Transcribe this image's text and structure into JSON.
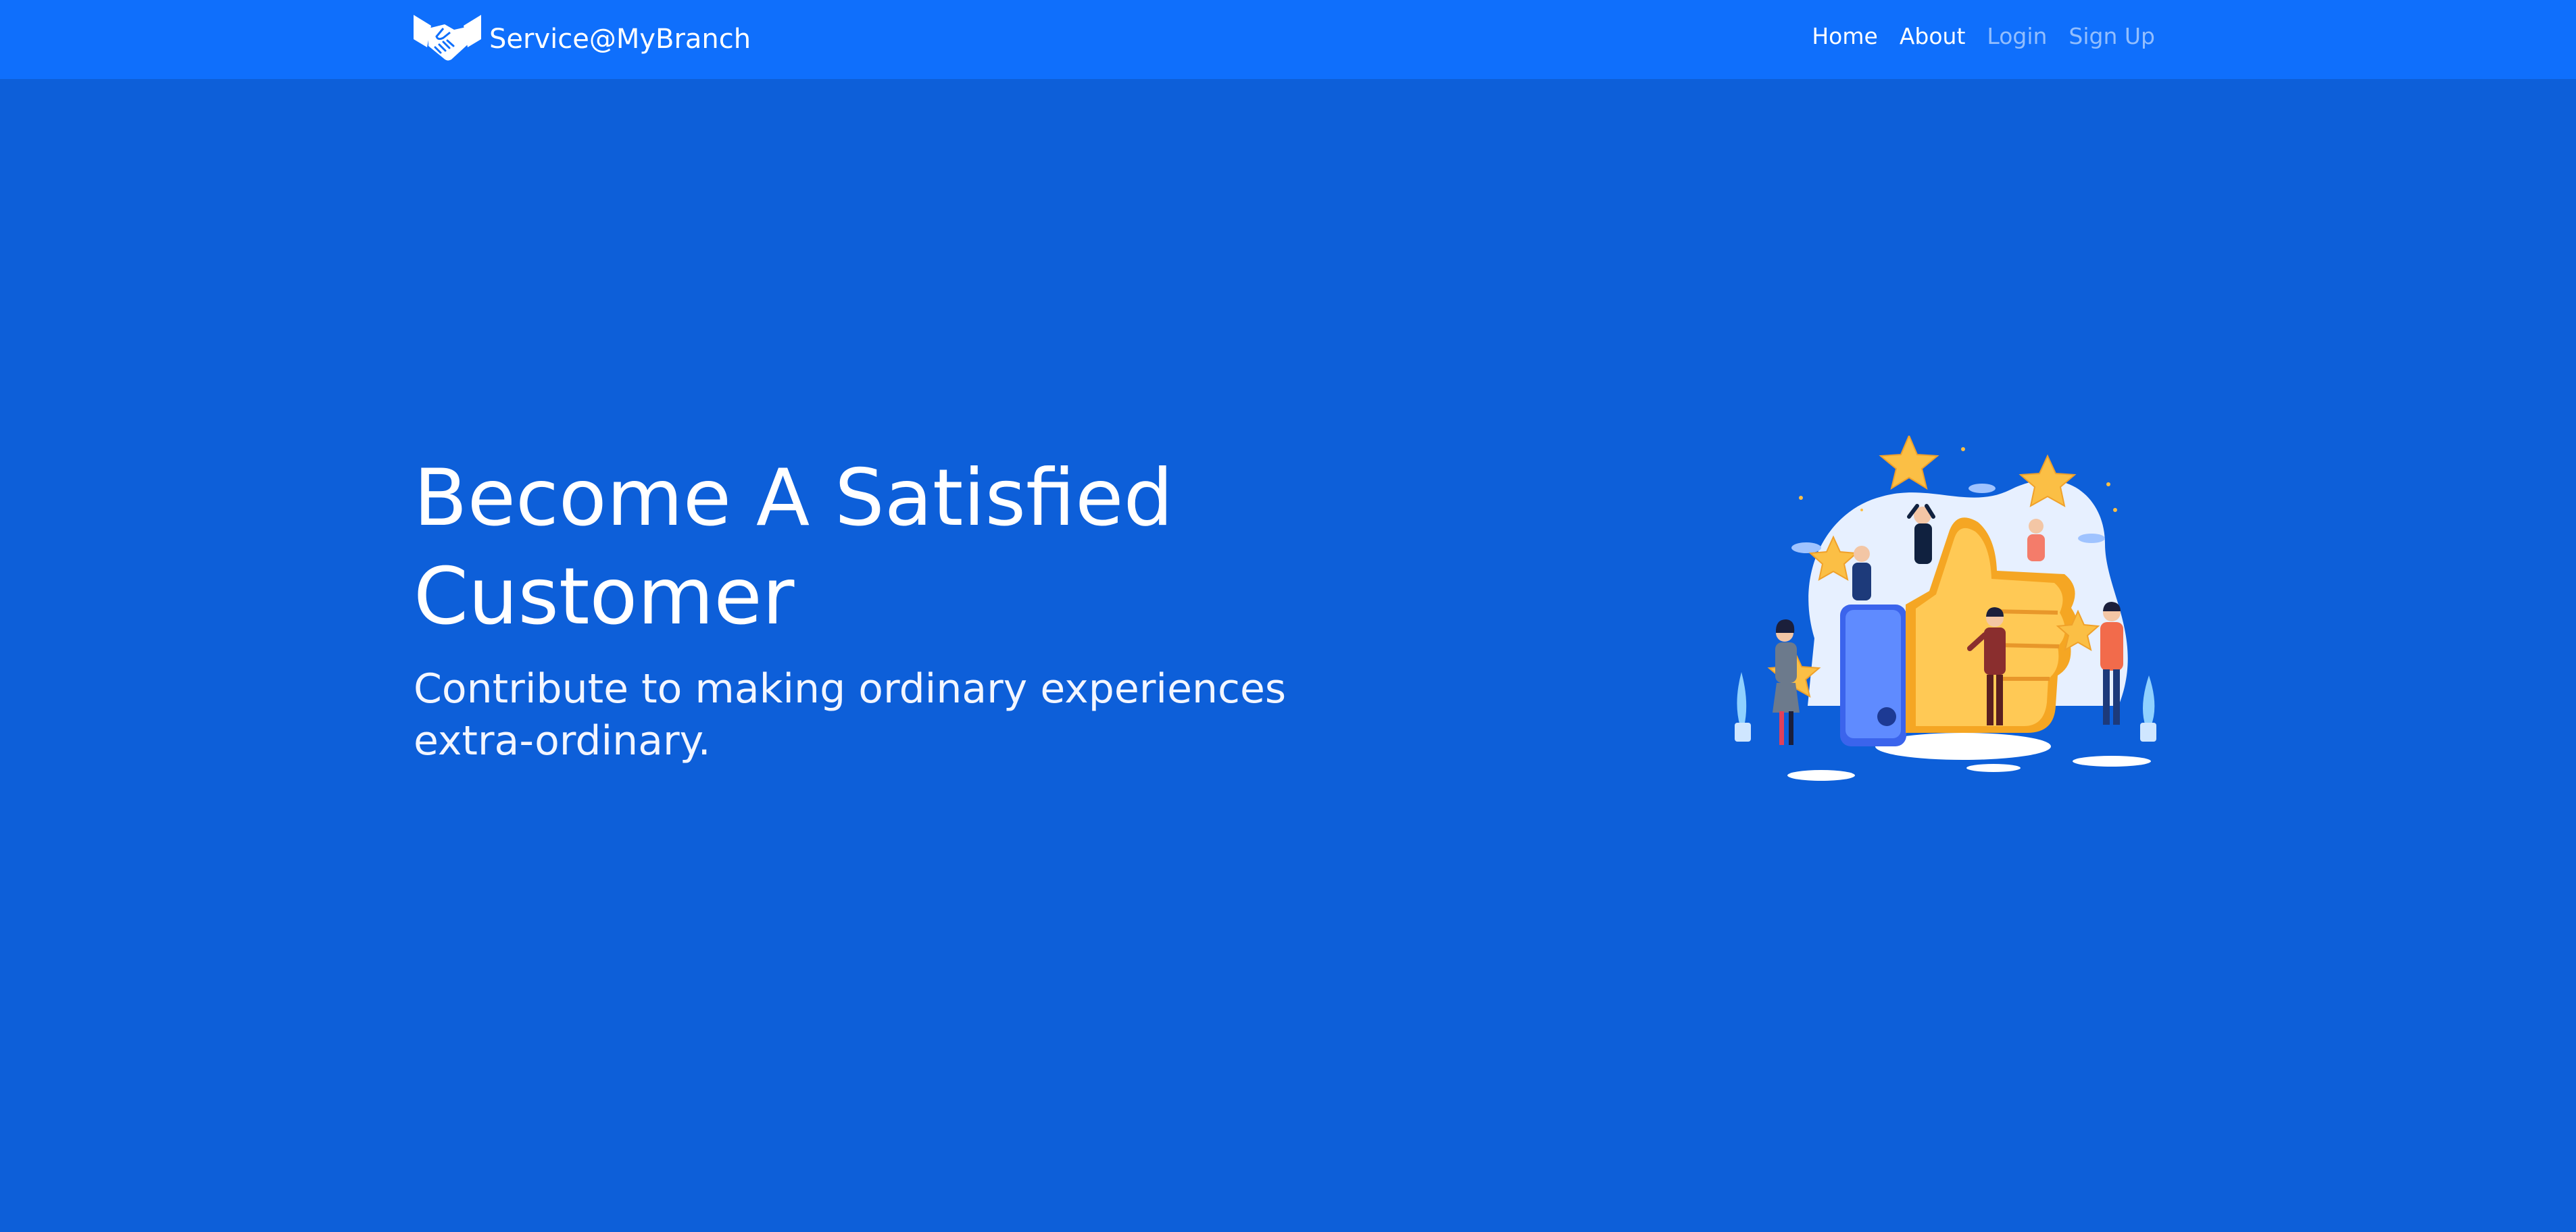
{
  "brand": {
    "logo_icon": "handshake-icon",
    "name": "Service@MyBranch"
  },
  "nav": {
    "items": [
      {
        "label": "Home",
        "state": "active"
      },
      {
        "label": "About",
        "state": "active"
      },
      {
        "label": "Login",
        "state": "muted"
      },
      {
        "label": "Sign Up",
        "state": "muted"
      }
    ]
  },
  "hero": {
    "title": "Become A Satisfied Customer",
    "subtitle": "Contribute to making ordinary experiences extra-ordinary.",
    "illustration_icon": "thumbs-up-illustration"
  },
  "colors": {
    "navbar_bg": "#0f6ffc",
    "page_bg": "#0d5fd9",
    "text": "#ffffff",
    "accent_yellow": "#fbbf45"
  }
}
